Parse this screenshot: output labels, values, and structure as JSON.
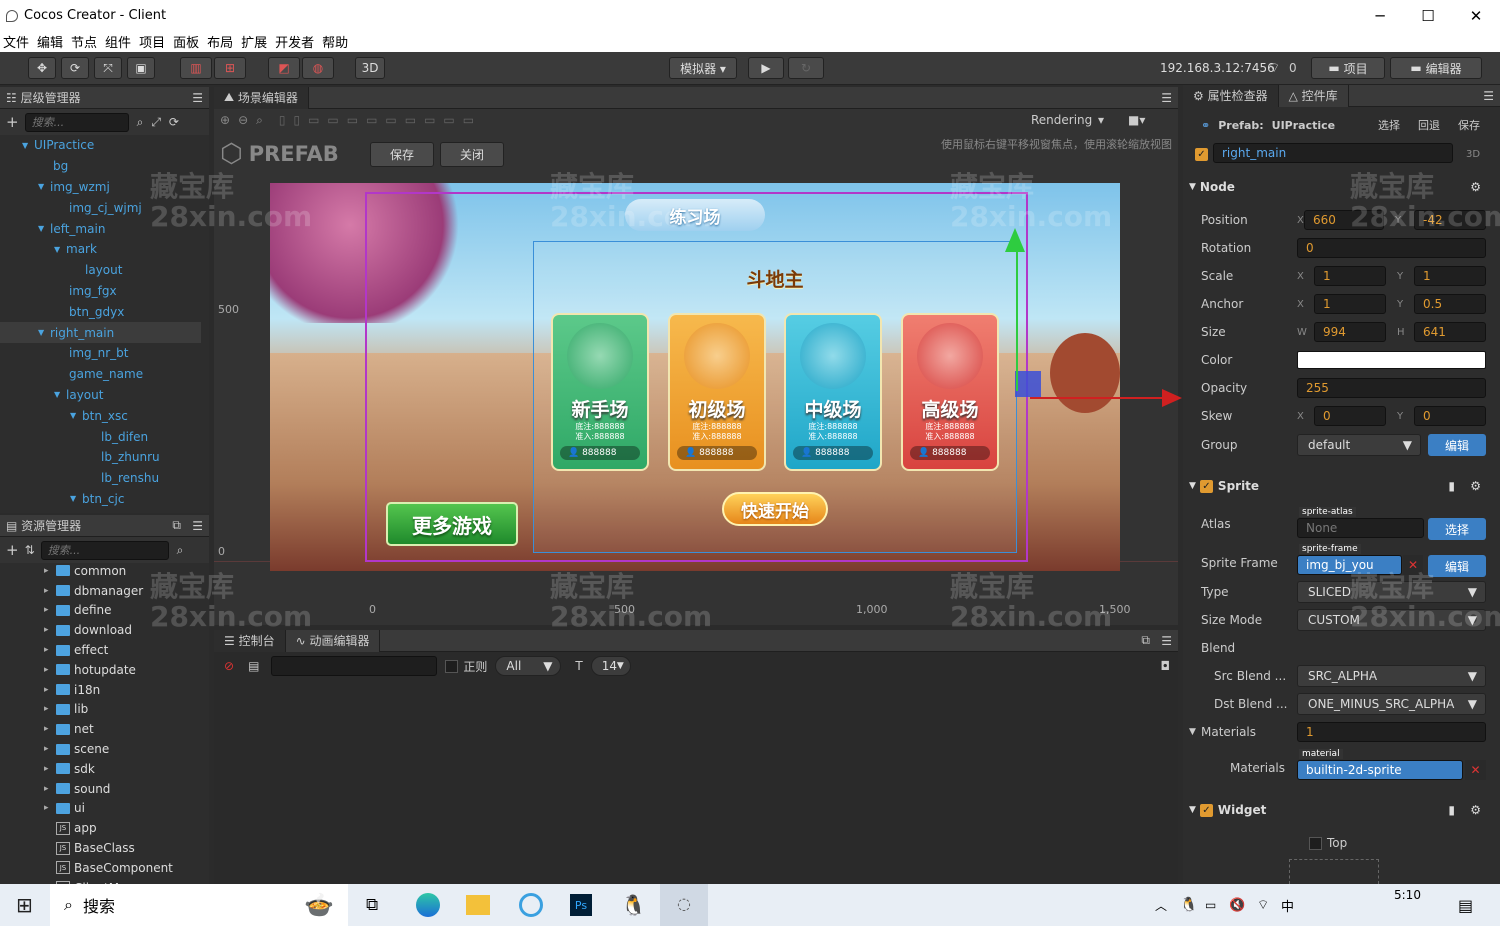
{
  "window": {
    "title": "Cocos Creator - Client",
    "min": "─",
    "max": "☐",
    "close": "✕"
  },
  "menu": [
    "文件",
    "编辑",
    "节点",
    "组件",
    "项目",
    "面板",
    "布局",
    "扩展",
    "开发者",
    "帮助"
  ],
  "toolbar": {
    "btn3d": "3D",
    "simulator": "模拟器 ▾",
    "play": "▶",
    "refresh": "↻",
    "ip": "192.168.3.12:7456",
    "wifi_count": "0",
    "project_btn": "项目",
    "editor_btn": "编辑器"
  },
  "hierarchy": {
    "title": "层级管理器",
    "search_placeholder": "搜索...",
    "nodes": [
      {
        "label": "UIPractice",
        "indent": 0,
        "arrow": "▼"
      },
      {
        "label": "bg",
        "indent": 1,
        "arrow": ""
      },
      {
        "label": "img_wzmj",
        "indent": 1,
        "arrow": "▼"
      },
      {
        "label": "img_cj_wjmj",
        "indent": 2,
        "arrow": ""
      },
      {
        "label": "left_main",
        "indent": 1,
        "arrow": "▼"
      },
      {
        "label": "mark",
        "indent": 2,
        "arrow": "▼"
      },
      {
        "label": "layout",
        "indent": 3,
        "arrow": ""
      },
      {
        "label": "img_fgx",
        "indent": 2,
        "arrow": ""
      },
      {
        "label": "btn_gdyx",
        "indent": 2,
        "arrow": ""
      },
      {
        "label": "right_main",
        "indent": 1,
        "arrow": "▼",
        "selected": true
      },
      {
        "label": "img_nr_bt",
        "indent": 2,
        "arrow": ""
      },
      {
        "label": "game_name",
        "indent": 2,
        "arrow": ""
      },
      {
        "label": "layout",
        "indent": 2,
        "arrow": "▼"
      },
      {
        "label": "btn_xsc",
        "indent": 3,
        "arrow": "▼"
      },
      {
        "label": "lb_difen",
        "indent": 4,
        "arrow": ""
      },
      {
        "label": "lb_zhunru",
        "indent": 4,
        "arrow": ""
      },
      {
        "label": "lb_renshu",
        "indent": 4,
        "arrow": ""
      },
      {
        "label": "btn_cjc",
        "indent": 3,
        "arrow": "▼"
      }
    ]
  },
  "assets": {
    "title": "资源管理器",
    "search_placeholder": "搜索...",
    "items": [
      {
        "label": "common",
        "type": "folder"
      },
      {
        "label": "dbmanager",
        "type": "folder"
      },
      {
        "label": "define",
        "type": "folder"
      },
      {
        "label": "download",
        "type": "folder"
      },
      {
        "label": "effect",
        "type": "folder"
      },
      {
        "label": "hotupdate",
        "type": "folder"
      },
      {
        "label": "i18n",
        "type": "folder"
      },
      {
        "label": "lib",
        "type": "folder"
      },
      {
        "label": "net",
        "type": "folder"
      },
      {
        "label": "scene",
        "type": "folder"
      },
      {
        "label": "sdk",
        "type": "folder"
      },
      {
        "label": "sound",
        "type": "folder"
      },
      {
        "label": "ui",
        "type": "folder"
      },
      {
        "label": "app",
        "type": "js"
      },
      {
        "label": "BaseClass",
        "type": "js"
      },
      {
        "label": "BaseComponent",
        "type": "js"
      },
      {
        "label": "ClientManager",
        "type": "js"
      }
    ]
  },
  "scene": {
    "title": "场景编辑器",
    "rendering": "Rendering",
    "prefab_label": "PREFAB",
    "save": "保存",
    "close": "关闭",
    "hint": "使用鼠标右键平移视窗焦点，使用滚轮缩放视图",
    "y500": "500",
    "y0": "0",
    "x0": "0",
    "x500": "500",
    "x1000": "1,000",
    "x1500": "1,500"
  },
  "game": {
    "banner": "练习场",
    "game_name": "斗地主",
    "more_games": "更多游戏",
    "quick_start": "快速开始",
    "cards": [
      {
        "title": "新手场",
        "base": "底注:888888",
        "entry": "准入:888888",
        "players": "888888",
        "color": "#2fa866",
        "circle": "#5cc98a"
      },
      {
        "title": "初级场",
        "base": "底注:888888",
        "entry": "准入:888888",
        "players": "888888",
        "color": "#e8901f",
        "circle": "#f7b94d"
      },
      {
        "title": "中级场",
        "base": "底注:888888",
        "entry": "准入:888888",
        "players": "888888",
        "color": "#1fa6c8",
        "circle": "#56cde3"
      },
      {
        "title": "高级场",
        "base": "底注:888888",
        "entry": "准入:888888",
        "players": "888888",
        "color": "#d8433f",
        "circle": "#f07e70"
      }
    ]
  },
  "console": {
    "tab1": "控制台",
    "tab2": "动画编辑器",
    "regex": "正则",
    "filter": "All",
    "font_size": "14"
  },
  "inspector": {
    "tab1": "属性检查器",
    "tab2": "控件库",
    "prefab_label": "Prefab:",
    "prefab_name": "UIPractice",
    "select": "选择",
    "revert": "回退",
    "save": "保存",
    "node_name": "right_main",
    "threeD": "3D",
    "node_section": "Node",
    "position": {
      "label": "Position",
      "x": "660",
      "y": "-42"
    },
    "rotation": {
      "label": "Rotation",
      "v": "0"
    },
    "scale": {
      "label": "Scale",
      "x": "1",
      "y": "1"
    },
    "anchor": {
      "label": "Anchor",
      "x": "1",
      "y": "0.5"
    },
    "size": {
      "label": "Size",
      "w": "994",
      "h": "641"
    },
    "color": {
      "label": "Color",
      "value": "#ffffff"
    },
    "opacity": {
      "label": "Opacity",
      "v": "255"
    },
    "skew": {
      "label": "Skew",
      "x": "0",
      "y": "0"
    },
    "group": {
      "label": "Group",
      "v": "default",
      "btn": "编辑"
    },
    "sprite_section": "Sprite",
    "atlas": {
      "label": "Atlas",
      "tag": "sprite-atlas",
      "v": "None",
      "btn": "选择"
    },
    "sprite_frame": {
      "label": "Sprite Frame",
      "tag": "sprite-frame",
      "v": "img_bj_you",
      "btn": "编辑"
    },
    "type": {
      "label": "Type",
      "v": "SLICED"
    },
    "size_mode": {
      "label": "Size Mode",
      "v": "CUSTOM"
    },
    "blend": {
      "label": "Blend"
    },
    "src_blend": {
      "label": "Src Blend ...",
      "v": "SRC_ALPHA"
    },
    "dst_blend": {
      "label": "Dst Blend ...",
      "v": "ONE_MINUS_SRC_ALPHA"
    },
    "materials_count": {
      "label": "Materials",
      "v": "1"
    },
    "materials": {
      "label": "Materials",
      "tag": "material",
      "v": "builtin-2d-sprite"
    },
    "widget_section": "Widget",
    "top": "Top"
  },
  "taskbar": {
    "search": "搜索",
    "time": "5:10",
    "ime": "中"
  },
  "watermark": {
    "line1": "藏宝库",
    "line2": "28xin.com"
  }
}
